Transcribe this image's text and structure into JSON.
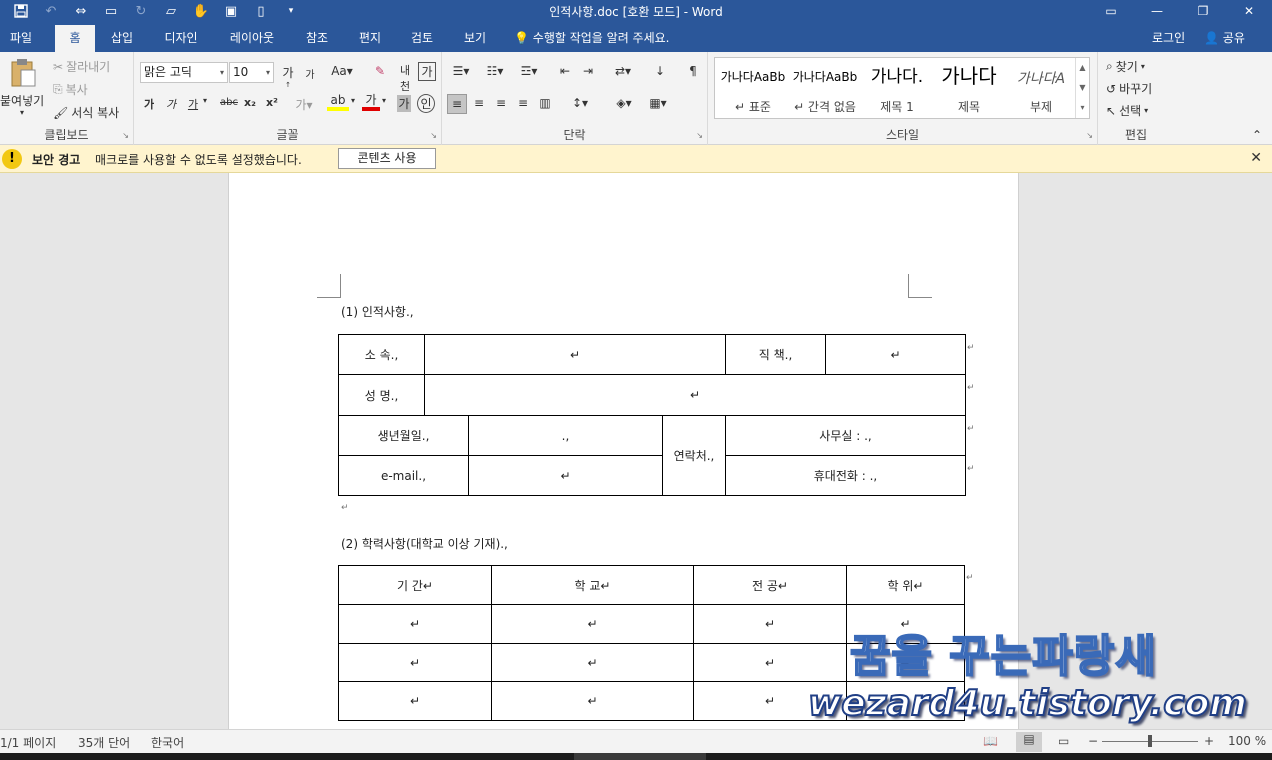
{
  "window": {
    "title": "인적사항.doc [호환 모드] - Word",
    "qat": [
      "save-icon",
      "undo-icon",
      "redo-icon"
    ]
  },
  "tabs": [
    "파일",
    "홈",
    "삽입",
    "디자인",
    "레이아웃",
    "참조",
    "편지",
    "검토",
    "보기"
  ],
  "active_tab": "홈",
  "tell_me": "수행할 작업을 알려 주세요.",
  "login": "로그인",
  "share": "공유",
  "ribbon": {
    "clipboard": {
      "label": "클립보드",
      "paste": "붙여넣기",
      "cut": "잘라내기",
      "copy": "복사",
      "format_painter": "서식 복사"
    },
    "font": {
      "label": "글꼴",
      "font_name": "맑은 고딕",
      "font_size": "10",
      "bold": "가",
      "italic": "가",
      "underline": "가",
      "strike": "abc",
      "subscript": "x₂",
      "superscript": "x²",
      "grow": "가",
      "shrink": "가",
      "clear": "가"
    },
    "paragraph": {
      "label": "단락"
    },
    "styles": {
      "label": "스타일",
      "items": [
        {
          "preview": "가나다AaBb",
          "name": "↵ 표준"
        },
        {
          "preview": "가나다AaBb",
          "name": "↵ 간격 없음"
        },
        {
          "preview": "가나다.",
          "name": "제목 1"
        },
        {
          "preview": "가나다",
          "name": "제목"
        },
        {
          "preview": "가나다A",
          "name": "부제"
        }
      ]
    },
    "editing": {
      "label": "편집",
      "find": "찾기",
      "replace": "바꾸기",
      "select": "선택"
    }
  },
  "security_bar": {
    "title": "보안 경고",
    "message": "매크로를 사용할 수 없도록 설정했습니다.",
    "button": "콘텐츠 사용"
  },
  "document": {
    "section1_title": "(1)  인적사항.,",
    "section2_title": "(2)  학력사항(대학교 이상 기재).,",
    "table1": {
      "affiliation": "소  속.,",
      "position": "직  책.,",
      "name": "성  명.,",
      "birth": "생년월일.,",
      "email": "e-mail.,",
      "contact": "연락처.,",
      "office": "사무실 :    .,",
      "mobile": "휴대전화 :   .,",
      "empty_mark": "↵",
      "dot_mark": ".,"
    },
    "table2": {
      "headers": [
        "기        간↵",
        "학          교↵",
        "전          공↵",
        "학       위↵"
      ],
      "cell_mark": "↵",
      "rows": 3
    },
    "para_mark": "↵"
  },
  "watermark": {
    "line1": "꿈을 꾸는파랑새",
    "line2": "wezard4u.tistory.com"
  },
  "status": {
    "page": "1/1 페이지",
    "words": "35개 단어",
    "language": "한국어",
    "zoom": "100 %",
    "zoom_percent": 100
  }
}
